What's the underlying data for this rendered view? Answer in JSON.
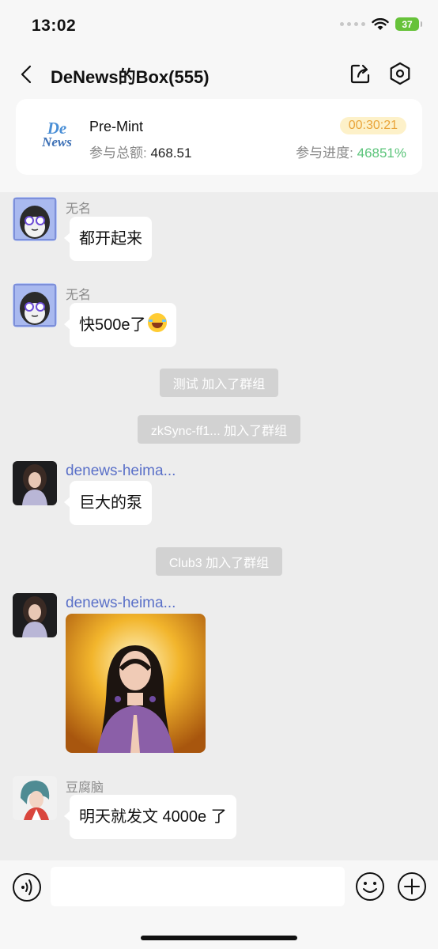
{
  "status_bar": {
    "time": "13:02",
    "battery": "37"
  },
  "header": {
    "title": "DeNews的Box(555)"
  },
  "card": {
    "logo_line1": "De",
    "logo_line2": "News",
    "name": "Pre-Mint",
    "total_label": "参与总额:",
    "total_value": "468.51",
    "timer": "00:30:21",
    "progress_label": "参与进度:",
    "progress_value": "46851%"
  },
  "messages": [
    {
      "sender": "无名",
      "text": "都开起来"
    },
    {
      "sender": "无名",
      "text": "快500e了"
    },
    {
      "system": "测试 加入了群组"
    },
    {
      "system": "zkSync-ff1... 加入了群组"
    },
    {
      "sender": "denews-heima...",
      "text": "巨大的泵"
    },
    {
      "system": "Club3 加入了群组"
    },
    {
      "sender": "denews-heima..."
    },
    {
      "sender": "豆腐脑",
      "text": "明天就发文 4000e 了"
    }
  ],
  "colors": {
    "accent_blue": "#5a70c8",
    "progress_green": "#5bc47a",
    "timer_orange": "#e9a43a"
  }
}
